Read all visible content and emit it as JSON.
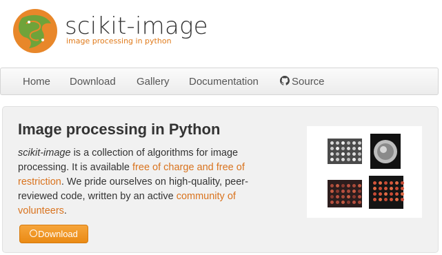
{
  "brand": {
    "name": "scikit-image",
    "tagline": "image processing in python",
    "colors": {
      "accent": "#e07a1a",
      "logo_green": "#6fa33a",
      "logo_orange": "#e8872a"
    }
  },
  "nav": {
    "items": [
      {
        "label": "Home"
      },
      {
        "label": "Download"
      },
      {
        "label": "Gallery"
      },
      {
        "label": "Documentation"
      },
      {
        "label": "Source",
        "icon": "github-icon"
      }
    ]
  },
  "hero": {
    "title": "Image processing in Python",
    "text": {
      "lib": "scikit-image",
      "p1": " is a collection of algorithms for image processing. It is available ",
      "link1": "free of charge and free of restriction",
      "p2": ". We pride ourselves on high-quality, peer-reviewed code, written by an active ",
      "link2": "community of volunteers",
      "p3": "."
    },
    "button_label": "Download",
    "button_icon": "download-circle-icon"
  }
}
